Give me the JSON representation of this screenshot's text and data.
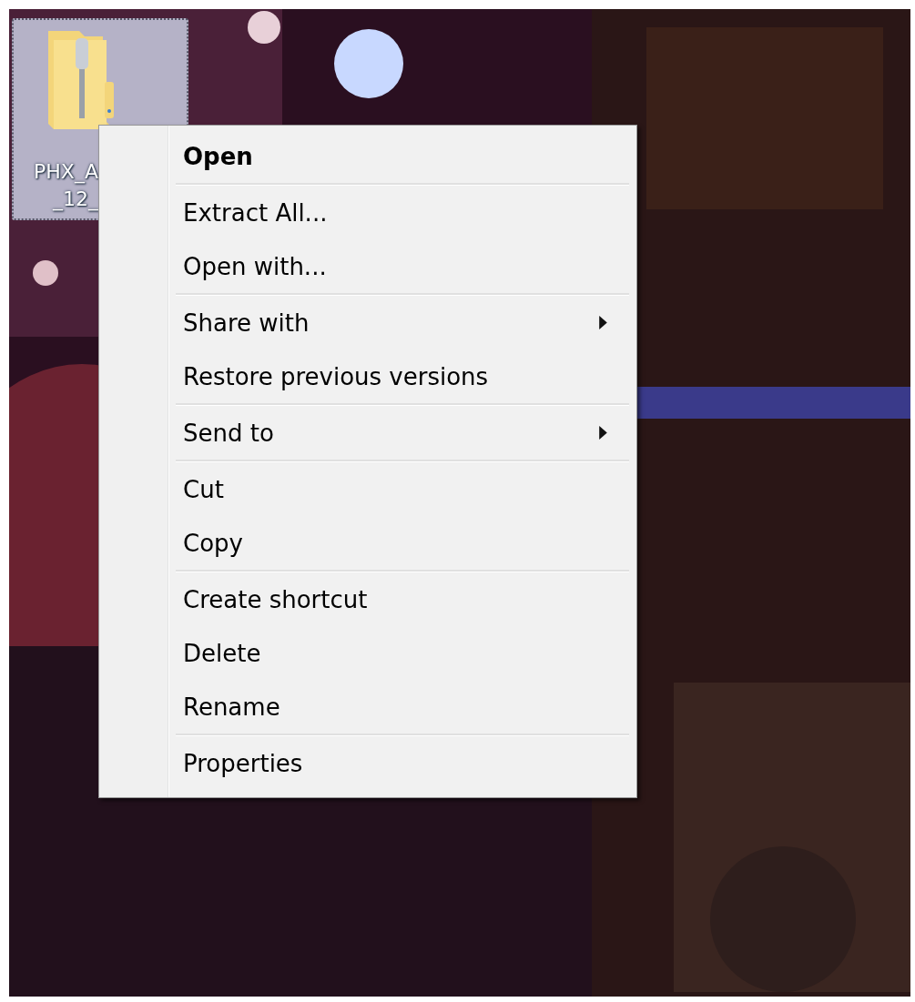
{
  "desktop": {
    "icons": [
      {
        "label_lines": [
          "PHX_A",
          "_12_"
        ],
        "selected": true
      }
    ]
  },
  "context_menu": {
    "groups": [
      [
        {
          "label": "Open",
          "default": true,
          "submenu": false
        }
      ],
      [
        {
          "label": "Extract All...",
          "default": false,
          "submenu": false
        },
        {
          "label": "Open with...",
          "default": false,
          "submenu": false
        }
      ],
      [
        {
          "label": "Share with",
          "default": false,
          "submenu": true
        },
        {
          "label": "Restore previous versions",
          "default": false,
          "submenu": false
        }
      ],
      [
        {
          "label": "Send to",
          "default": false,
          "submenu": true
        }
      ],
      [
        {
          "label": "Cut",
          "default": false,
          "submenu": false
        },
        {
          "label": "Copy",
          "default": false,
          "submenu": false
        }
      ],
      [
        {
          "label": "Create shortcut",
          "default": false,
          "submenu": false
        },
        {
          "label": "Delete",
          "default": false,
          "submenu": false
        },
        {
          "label": "Rename",
          "default": false,
          "submenu": false
        }
      ],
      [
        {
          "label": "Properties",
          "default": false,
          "submenu": false
        }
      ]
    ]
  }
}
